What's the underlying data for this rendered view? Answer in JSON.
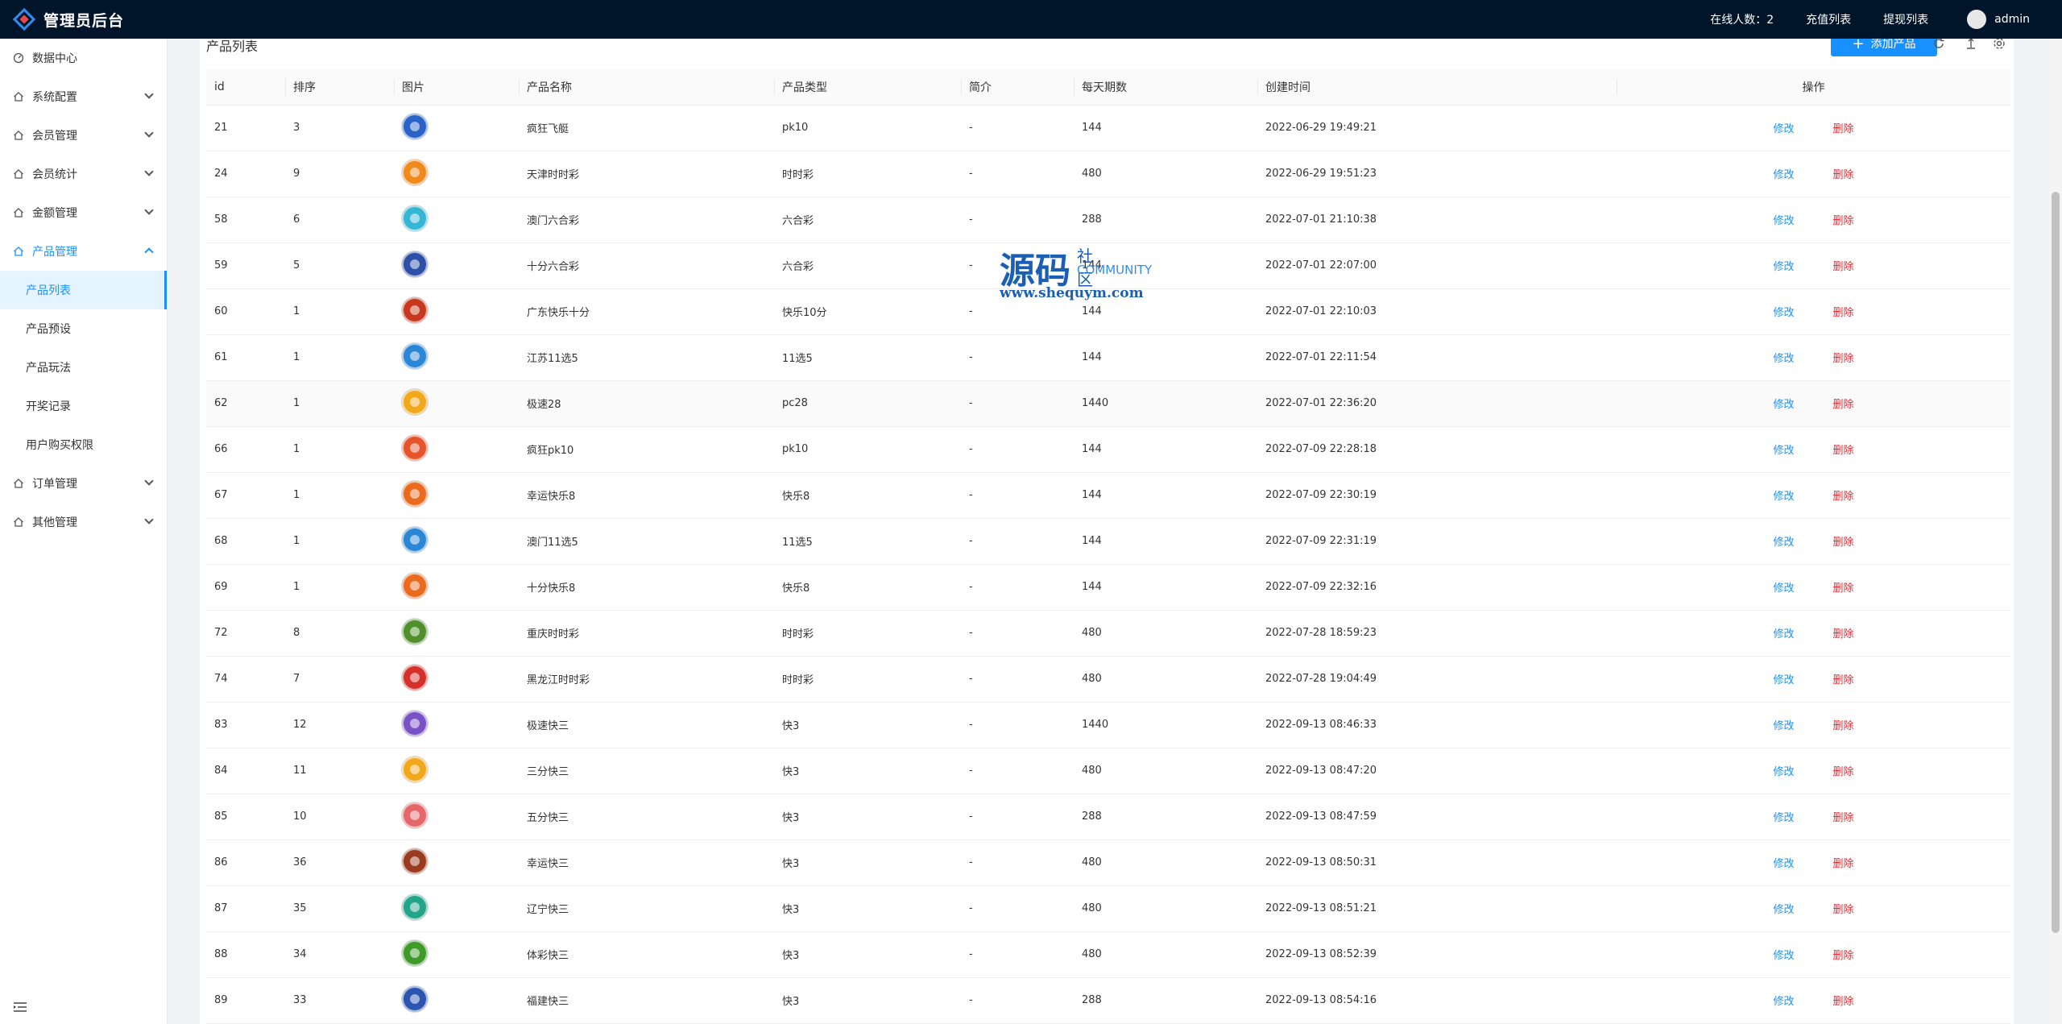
{
  "header": {
    "title": "管理员后台",
    "online": "在线人数：2",
    "recharge": "充值列表",
    "withdraw": "提现列表",
    "user": "admin"
  },
  "sidebar": {
    "items": [
      {
        "label": "数据中心"
      },
      {
        "label": "系统配置"
      },
      {
        "label": "会员管理"
      },
      {
        "label": "会员统计"
      },
      {
        "label": "金额管理"
      },
      {
        "label": "产品管理"
      },
      {
        "label": "订单管理"
      },
      {
        "label": "其他管理"
      }
    ],
    "sub": [
      {
        "label": "产品列表"
      },
      {
        "label": "产品预设"
      },
      {
        "label": "产品玩法"
      },
      {
        "label": "开奖记录"
      },
      {
        "label": "用户购买权限"
      }
    ]
  },
  "main": {
    "title": "产品列表",
    "add_button": "添加产品",
    "columns": [
      "id",
      "排序",
      "图片",
      "产品名称",
      "产品类型",
      "简介",
      "每天期数",
      "创建时间",
      "操作"
    ],
    "edit_label": "修改",
    "delete_label": "删除",
    "rows": [
      {
        "id": "21",
        "sort": "3",
        "color": "#2a63c8",
        "name": "疯狂飞艇",
        "type": "pk10",
        "desc": "-",
        "daily": "144",
        "created": "2022-06-29 19:49:21"
      },
      {
        "id": "24",
        "sort": "9",
        "color": "#f08a1c",
        "name": "天津时时彩",
        "type": "时时彩",
        "desc": "-",
        "daily": "480",
        "created": "2022-06-29 19:51:23"
      },
      {
        "id": "58",
        "sort": "6",
        "color": "#35b6d4",
        "name": "澳门六合彩",
        "type": "六合彩",
        "desc": "-",
        "daily": "288",
        "created": "2022-07-01 21:10:38"
      },
      {
        "id": "59",
        "sort": "5",
        "color": "#2c4fa8",
        "name": "十分六合彩",
        "type": "六合彩",
        "desc": "-",
        "daily": "144",
        "created": "2022-07-01 22:07:00"
      },
      {
        "id": "60",
        "sort": "1",
        "color": "#c8381e",
        "name": "广东快乐十分",
        "type": "快乐10分",
        "desc": "-",
        "daily": "144",
        "created": "2022-07-01 22:10:03"
      },
      {
        "id": "61",
        "sort": "1",
        "color": "#2c86d6",
        "name": "江苏11选5",
        "type": "11选5",
        "desc": "-",
        "daily": "144",
        "created": "2022-07-01 22:11:54"
      },
      {
        "id": "62",
        "sort": "1",
        "color": "#f2a81d",
        "name": "极速28",
        "type": "pc28",
        "desc": "-",
        "daily": "1440",
        "created": "2022-07-01 22:36:20"
      },
      {
        "id": "66",
        "sort": "1",
        "color": "#e5542a",
        "name": "疯狂pk10",
        "type": "pk10",
        "desc": "-",
        "daily": "144",
        "created": "2022-07-09 22:28:18"
      },
      {
        "id": "67",
        "sort": "1",
        "color": "#ea6a1e",
        "name": "幸运快乐8",
        "type": "快乐8",
        "desc": "-",
        "daily": "144",
        "created": "2022-07-09 22:30:19"
      },
      {
        "id": "68",
        "sort": "1",
        "color": "#2c86d6",
        "name": "澳门11选5",
        "type": "11选5",
        "desc": "-",
        "daily": "144",
        "created": "2022-07-09 22:31:19"
      },
      {
        "id": "69",
        "sort": "1",
        "color": "#ea6a1e",
        "name": "十分快乐8",
        "type": "快乐8",
        "desc": "-",
        "daily": "144",
        "created": "2022-07-09 22:32:16"
      },
      {
        "id": "72",
        "sort": "8",
        "color": "#4f8f2c",
        "name": "重庆时时彩",
        "type": "时时彩",
        "desc": "-",
        "daily": "480",
        "created": "2022-07-28 18:59:23"
      },
      {
        "id": "74",
        "sort": "7",
        "color": "#d6302a",
        "name": "黑龙江时时彩",
        "type": "时时彩",
        "desc": "-",
        "daily": "480",
        "created": "2022-07-28 19:04:49"
      },
      {
        "id": "83",
        "sort": "12",
        "color": "#7a52c8",
        "name": "极速快三",
        "type": "快3",
        "desc": "-",
        "daily": "1440",
        "created": "2022-09-13 08:46:33"
      },
      {
        "id": "84",
        "sort": "11",
        "color": "#f2a81d",
        "name": "三分快三",
        "type": "快3",
        "desc": "-",
        "daily": "480",
        "created": "2022-09-13 08:47:20"
      },
      {
        "id": "85",
        "sort": "10",
        "color": "#e5676a",
        "name": "五分快三",
        "type": "快3",
        "desc": "-",
        "daily": "288",
        "created": "2022-09-13 08:47:59"
      },
      {
        "id": "86",
        "sort": "36",
        "color": "#9a3a1e",
        "name": "幸运快三",
        "type": "快3",
        "desc": "-",
        "daily": "480",
        "created": "2022-09-13 08:50:31"
      },
      {
        "id": "87",
        "sort": "35",
        "color": "#24a58a",
        "name": "辽宁快三",
        "type": "快3",
        "desc": "-",
        "daily": "480",
        "created": "2022-09-13 08:51:21"
      },
      {
        "id": "88",
        "sort": "34",
        "color": "#3f9a2a",
        "name": "体彩快三",
        "type": "快3",
        "desc": "-",
        "daily": "480",
        "created": "2022-09-13 08:52:39"
      },
      {
        "id": "89",
        "sort": "33",
        "color": "#2c55b2",
        "name": "福建快三",
        "type": "快3",
        "desc": "-",
        "daily": "288",
        "created": "2022-09-13 08:54:16"
      }
    ]
  },
  "watermark": {
    "big": "源码",
    "small": "社区",
    "community": "COMMUNITY",
    "url": "www.shequym.com"
  }
}
